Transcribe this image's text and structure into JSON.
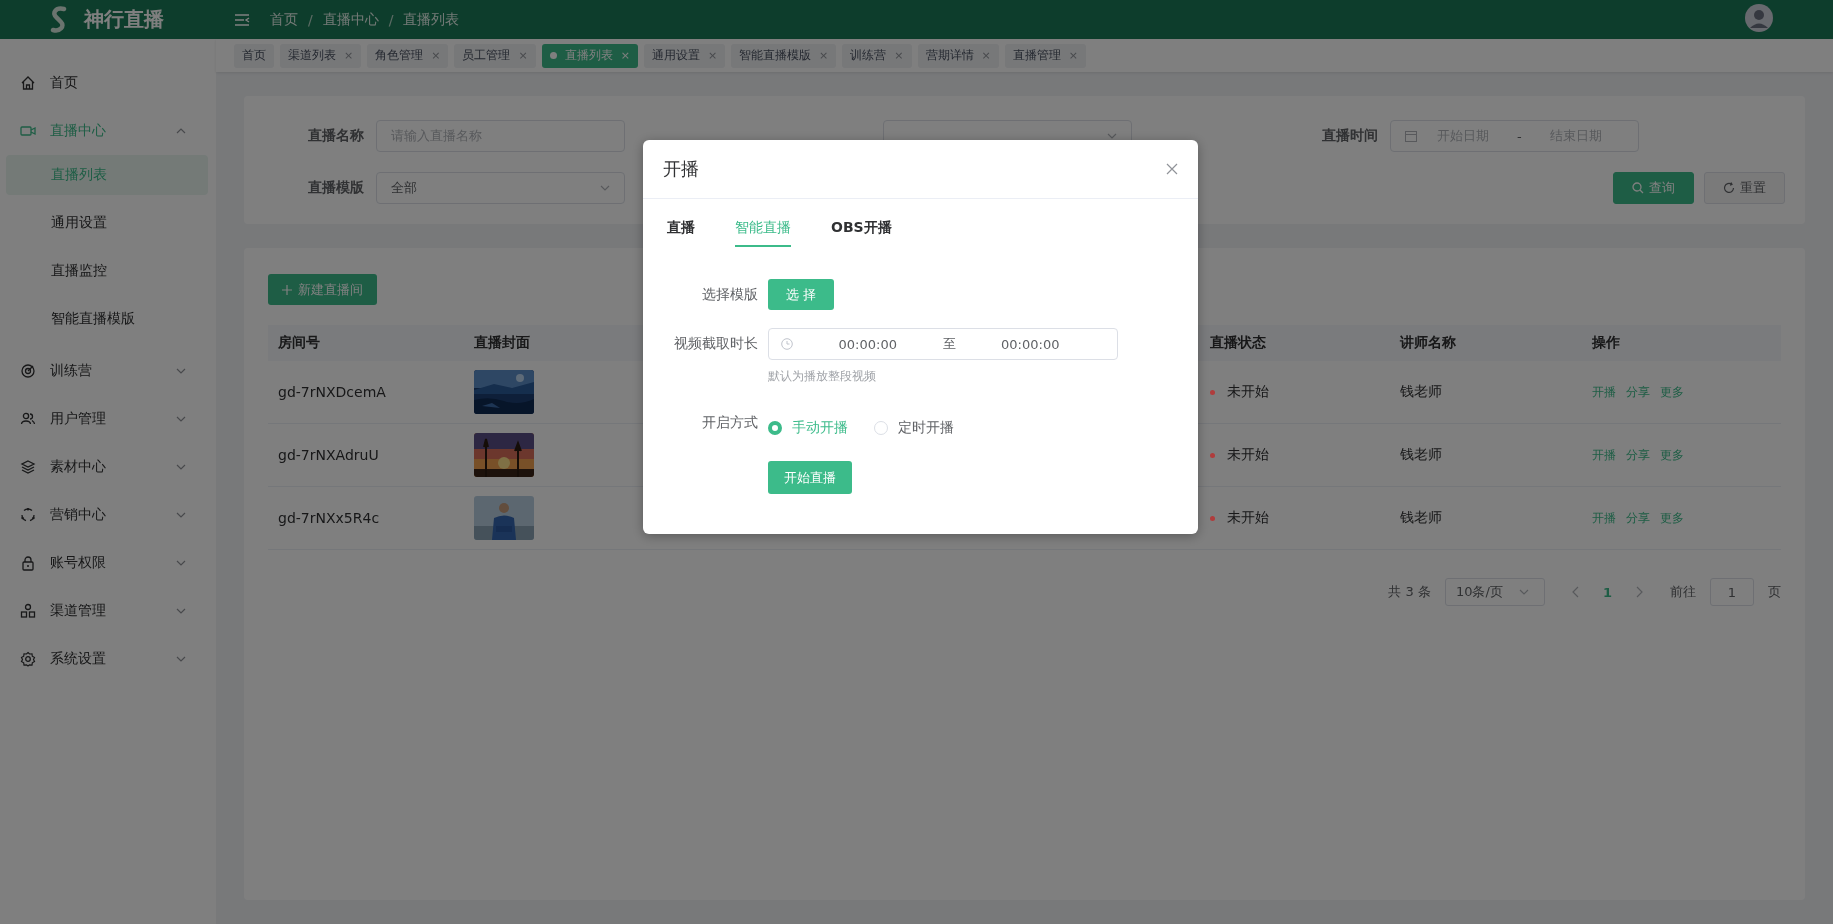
{
  "header": {
    "brand": "神行直播",
    "breadcrumb": [
      "首页",
      "直播中心",
      "直播列表"
    ],
    "breadcrumb_separator": "/"
  },
  "tags": [
    {
      "label": "首页",
      "selected": false,
      "closable": false
    },
    {
      "label": "渠道列表",
      "selected": false,
      "closable": true
    },
    {
      "label": "角色管理",
      "selected": false,
      "closable": true
    },
    {
      "label": "员工管理",
      "selected": false,
      "closable": true
    },
    {
      "label": "直播列表",
      "selected": true,
      "closable": true
    },
    {
      "label": "通用设置",
      "selected": false,
      "closable": true
    },
    {
      "label": "智能直播模版",
      "selected": false,
      "closable": true
    },
    {
      "label": "训练营",
      "selected": false,
      "closable": true
    },
    {
      "label": "营期详情",
      "selected": false,
      "closable": true
    },
    {
      "label": "直播管理",
      "selected": false,
      "closable": true
    }
  ],
  "tag_close": "×",
  "sidebar": {
    "items": [
      {
        "label": "首页",
        "kind": "home",
        "expandable": false,
        "expanded": false
      },
      {
        "label": "直播中心",
        "kind": "camera",
        "expandable": true,
        "expanded": true,
        "children": [
          {
            "label": "直播列表",
            "selected": true
          },
          {
            "label": "通用设置",
            "selected": false
          },
          {
            "label": "直播监控",
            "selected": false
          },
          {
            "label": "智能直播模版",
            "selected": false
          }
        ]
      },
      {
        "label": "训练营",
        "kind": "target",
        "expandable": true,
        "expanded": false
      },
      {
        "label": "用户管理",
        "kind": "users",
        "expandable": true,
        "expanded": false
      },
      {
        "label": "素材中心",
        "kind": "layers",
        "expandable": true,
        "expanded": false
      },
      {
        "label": "营销中心",
        "kind": "cycle",
        "expandable": true,
        "expanded": false
      },
      {
        "label": "账号权限",
        "kind": "lock",
        "expandable": true,
        "expanded": false
      },
      {
        "label": "渠道管理",
        "kind": "nodes",
        "expandable": true,
        "expanded": false
      },
      {
        "label": "系统设置",
        "kind": "gear",
        "expandable": true,
        "expanded": false
      }
    ]
  },
  "filters": [
    {
      "label": "直播名称",
      "kind": "input",
      "placeholder": "请输入直播名称"
    },
    {
      "kind": "select"
    },
    {
      "label": "直播时间",
      "kind": "daterange",
      "start_placeholder": "开始日期",
      "separator": "-",
      "end_placeholder": "结束日期"
    },
    {
      "label": "直播模版",
      "kind": "select",
      "value": "全部"
    }
  ],
  "filter_buttons": [
    {
      "label": "查询",
      "kind": "primary"
    },
    {
      "label": "重置",
      "kind": "default"
    }
  ],
  "new_button": "新建直播间",
  "table": {
    "columns": [
      "房间号",
      "直播封面",
      "直播状态",
      "讲师名称",
      "操作"
    ],
    "rows": [
      {
        "room": "gd-7rNXDcemA",
        "cover": {
          "kind": "picture"
        },
        "status": "未开始",
        "color": "#b03c3c",
        "teacher": "钱老师",
        "actions": [
          "开播",
          "分享",
          "更多"
        ]
      },
      {
        "room": "gd-7rNXAdruU",
        "cover": {
          "kind": "picture"
        },
        "status": "未开始",
        "color": "#b03c3c",
        "teacher": "钱老师",
        "actions": [
          "开播",
          "分享",
          "更多"
        ]
      },
      {
        "room": "gd-7rNXx5R4c",
        "cover": {
          "kind": "picture"
        },
        "status": "未开始",
        "color": "#b03c3c",
        "teacher": "钱老师",
        "actions": [
          "开播",
          "分享",
          "更多"
        ]
      }
    ]
  },
  "pagination": {
    "total": "共 3 条",
    "page_size": "10条/页",
    "pages": [
      {
        "label": "1",
        "selected": true
      }
    ],
    "goto_label": "前往",
    "goto_value": "1",
    "goto_suffix": "页"
  },
  "dialog": {
    "title": "开播",
    "tabs": [
      {
        "label": "直播",
        "selected": false
      },
      {
        "label": "智能直播",
        "selected": true
      },
      {
        "label": "OBS开播",
        "selected": false
      }
    ],
    "template_label": "选择模版",
    "template_button": "选 择",
    "duration_label": "视频截取时长",
    "duration_start": "00:00:00",
    "duration_separator": "至",
    "duration_end": "00:00:00",
    "duration_hint": "默认为播放整段视频",
    "mode_label": "开启方式",
    "modes": [
      {
        "label": "手动开播",
        "selected": true
      },
      {
        "label": "定时开播",
        "selected": false
      }
    ],
    "submit": "开始直播"
  }
}
